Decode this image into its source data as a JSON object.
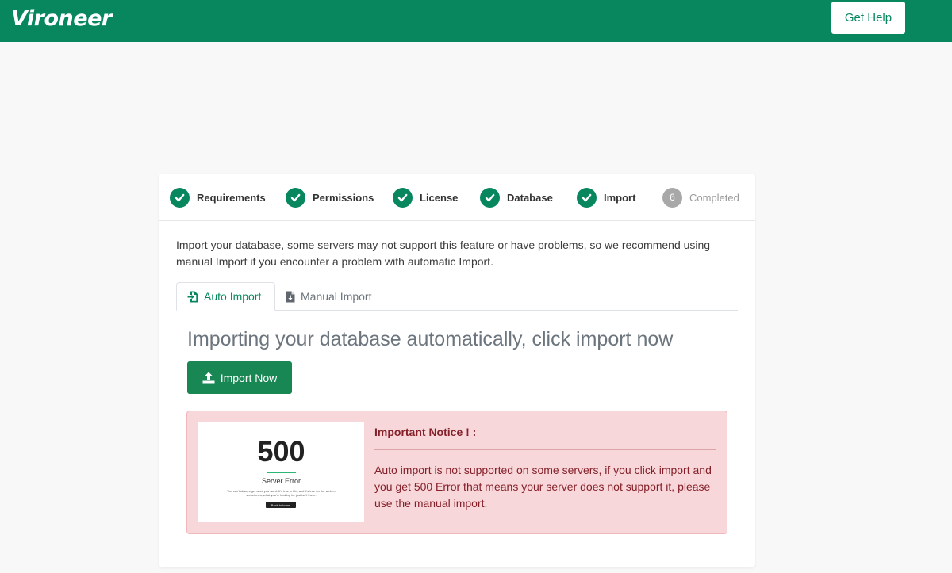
{
  "brand": {
    "name": "Vironeer"
  },
  "header": {
    "get_help_label": "Get Help"
  },
  "steps": [
    {
      "label": "Requirements",
      "status": "done"
    },
    {
      "label": "Permissions",
      "status": "done"
    },
    {
      "label": "License",
      "status": "done"
    },
    {
      "label": "Database",
      "status": "done"
    },
    {
      "label": "Import",
      "status": "done"
    },
    {
      "label": "Completed",
      "status": "pending",
      "number": "6"
    }
  ],
  "intro_text": "Import your database, some servers may not support this feature or have problems, so we recommend using manual Import if you encounter a problem with automatic Import.",
  "tabs": [
    {
      "label": "Auto Import",
      "active": true
    },
    {
      "label": "Manual Import",
      "active": false
    }
  ],
  "main": {
    "heading": "Importing your database automatically, click import now",
    "import_button": "Import Now"
  },
  "notice": {
    "image": {
      "code": "500",
      "title": "Server Error",
      "text": "You can't always get what you want. It's true in life, and it's true on the web — sometimes, what you're looking for just isn't there.",
      "button": "Back to home"
    },
    "title": "Important Notice ! :",
    "text": "Auto import is not supported on some servers, if you click import and you get 500 Error that means your server does not support it, please use the manual import."
  },
  "colors": {
    "brand": "#08875f",
    "button": "#198754",
    "notice_bg": "#f8d7da",
    "notice_text": "#842029",
    "pending": "#a8a8a8"
  }
}
